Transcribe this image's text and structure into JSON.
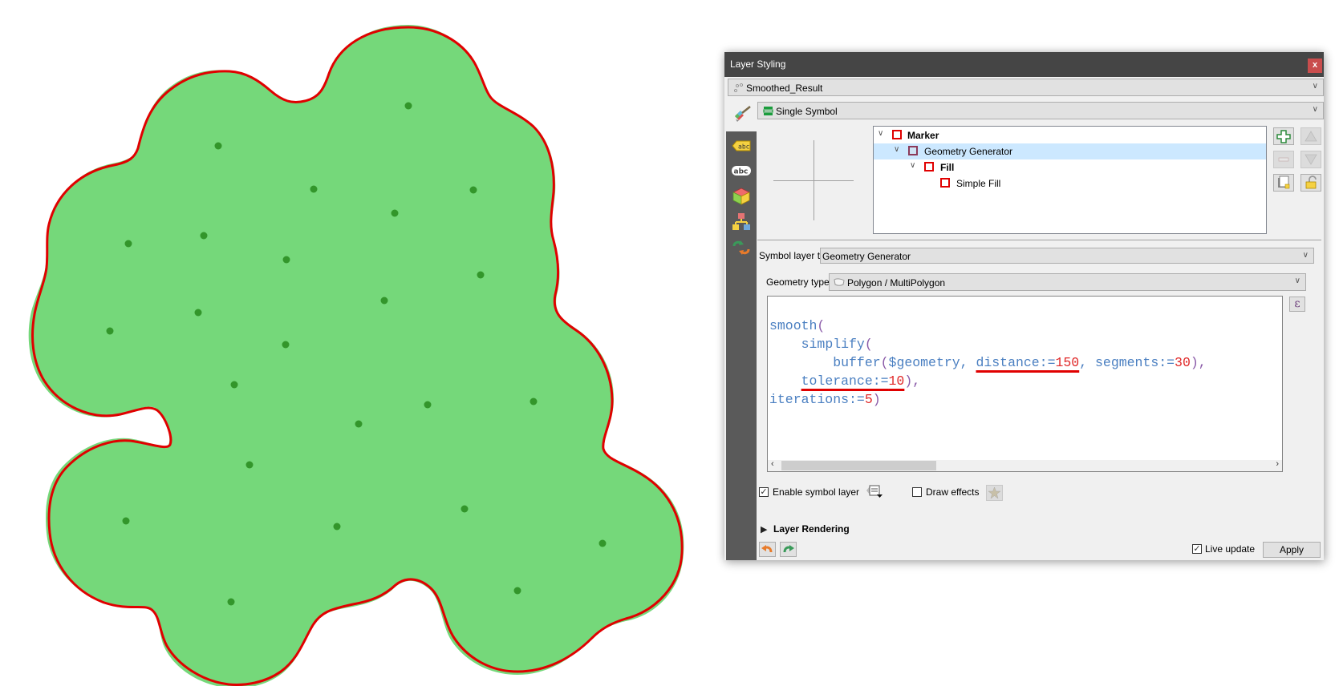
{
  "map": {
    "fill_color": "#75d87a",
    "outline_color": "#e00000",
    "point_color": "#33962b",
    "points_count": 24
  },
  "dialog": {
    "title": "Layer Styling",
    "close_label": "x",
    "layer_combo": {
      "value": "Smoothed_Result"
    },
    "renderer_combo": {
      "value": "Single Symbol"
    },
    "sidebar": {
      "items": [
        {
          "name": "symbology",
          "icon": "paintbrush-icon"
        },
        {
          "name": "labels",
          "icon": "label-abc-yellow-icon"
        },
        {
          "name": "masks",
          "icon": "label-abc-outline-icon"
        },
        {
          "name": "3d-view",
          "icon": "3d-cube-icon"
        },
        {
          "name": "diagrams",
          "icon": "diagram-icon"
        },
        {
          "name": "history",
          "icon": "undo-redo-icon"
        }
      ]
    },
    "symbol_tree": [
      {
        "label": "Marker",
        "bold": true,
        "level": 0,
        "expanded": true,
        "selected": false
      },
      {
        "label": "Geometry Generator",
        "bold": false,
        "level": 1,
        "expanded": true,
        "selected": true
      },
      {
        "label": "Fill",
        "bold": true,
        "level": 2,
        "expanded": true,
        "selected": false
      },
      {
        "label": "Simple Fill",
        "bold": false,
        "level": 3,
        "expanded": false,
        "selected": false
      }
    ],
    "symbol_layer_type": {
      "label": "Symbol layer type",
      "value": "Geometry Generator"
    },
    "geometry_type": {
      "label": "Geometry type",
      "value": "Polygon / MultiPolygon"
    },
    "expression": {
      "lines": [
        "smooth(",
        "    simplify(",
        "        buffer($geometry, distance:=150, segments:=30),",
        "    tolerance:=10),",
        "iterations:=5)"
      ],
      "tokens": {
        "l1_fn": "smooth",
        "l2_fn": "simplify",
        "l3_fn": "buffer",
        "l3_arg": "$geometry, ",
        "l3_dist_name": "distance:=",
        "l3_dist_val": "150",
        "l3_seg_name": ", segments:=",
        "l3_seg_val": "30",
        "l3_tail": "),",
        "l4_tol_name": "tolerance:=",
        "l4_tol_val": "10",
        "l4_tail": "),",
        "l5_it_name": "iterations:=",
        "l5_it_val": "5",
        "l5_tail": ")"
      }
    },
    "epsilon_label": "ε",
    "enable_symbol_layer": {
      "label": "Enable symbol layer",
      "checked": true
    },
    "draw_effects": {
      "label": "Draw effects",
      "checked": false
    },
    "layer_rendering": {
      "label": "Layer Rendering",
      "expanded": false
    },
    "live_update": {
      "label": "Live update",
      "checked": true
    },
    "apply_label": "Apply"
  }
}
